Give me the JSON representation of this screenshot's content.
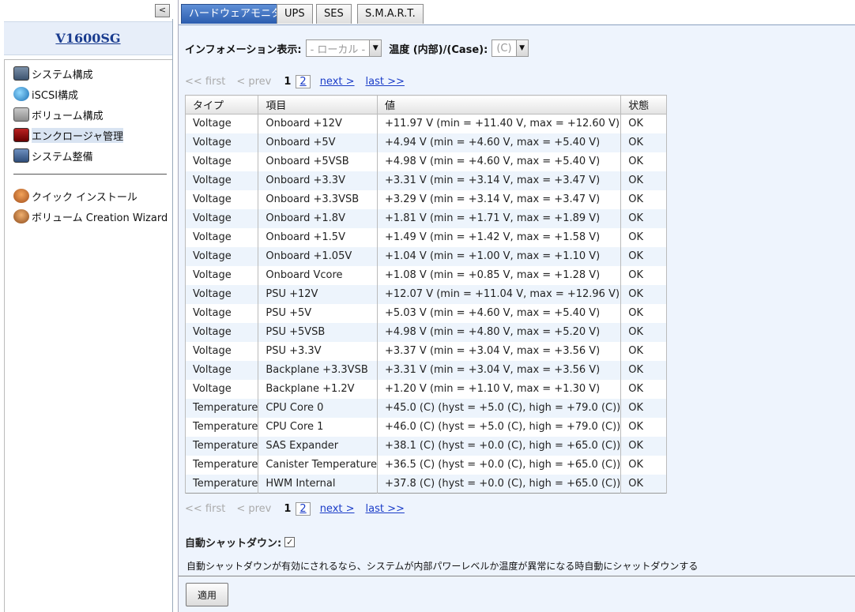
{
  "sidebar": {
    "collapse_glyph": "<",
    "device_name": "V1600SG",
    "nav_items": [
      {
        "label": "システム構成",
        "icon": "system-config-icon"
      },
      {
        "label": "iSCSI構成",
        "icon": "iscsi-globe-icon"
      },
      {
        "label": "ボリューム構成",
        "icon": "volume-disk-icon"
      },
      {
        "label": "エンクロージャ管理",
        "icon": "enclosure-monitor-icon",
        "active": true
      },
      {
        "label": "システム整備",
        "icon": "maintenance-icon"
      }
    ],
    "wizard_items": [
      {
        "label": "クイック インストール",
        "icon": "quick-install-icon"
      },
      {
        "label": "ボリューム Creation Wizard",
        "icon": "volume-wizard-icon"
      }
    ]
  },
  "tabs": [
    {
      "label": "ハードウェアモニタ",
      "active": true
    },
    {
      "label": "UPS"
    },
    {
      "label": "SES"
    },
    {
      "label": "S.M.A.R.T."
    }
  ],
  "info": {
    "label": "インフォメーション表示:",
    "select_value": "- ローカル -",
    "temp_label": "温度 (内部)/(Case):",
    "temp_value": "(C)"
  },
  "pager": {
    "first": "<< first",
    "prev": "< prev",
    "current": "1",
    "page2": "2",
    "next": "next >",
    "last": "last >>"
  },
  "table": {
    "headers": [
      "タイプ",
      "項目",
      "値",
      "状態"
    ],
    "rows": [
      [
        "Voltage",
        "Onboard +12V",
        "+11.97 V (min = +11.40 V, max = +12.60 V)",
        "OK"
      ],
      [
        "Voltage",
        "Onboard +5V",
        "+4.94 V (min = +4.60 V, max = +5.40 V)",
        "OK"
      ],
      [
        "Voltage",
        "Onboard +5VSB",
        "+4.98 V (min = +4.60 V, max = +5.40 V)",
        "OK"
      ],
      [
        "Voltage",
        "Onboard +3.3V",
        "+3.31 V (min = +3.14 V, max = +3.47 V)",
        "OK"
      ],
      [
        "Voltage",
        "Onboard +3.3VSB",
        "+3.29 V (min = +3.14 V, max = +3.47 V)",
        "OK"
      ],
      [
        "Voltage",
        "Onboard +1.8V",
        "+1.81 V (min = +1.71 V, max = +1.89 V)",
        "OK"
      ],
      [
        "Voltage",
        "Onboard +1.5V",
        "+1.49 V (min = +1.42 V, max = +1.58 V)",
        "OK"
      ],
      [
        "Voltage",
        "Onboard +1.05V",
        "+1.04 V (min = +1.00 V, max = +1.10 V)",
        "OK"
      ],
      [
        "Voltage",
        "Onboard Vcore",
        "+1.08 V (min = +0.85 V, max = +1.28 V)",
        "OK"
      ],
      [
        "Voltage",
        "PSU +12V",
        "+12.07 V (min = +11.04 V, max = +12.96 V)",
        "OK"
      ],
      [
        "Voltage",
        "PSU +5V",
        "+5.03 V (min = +4.60 V, max = +5.40 V)",
        "OK"
      ],
      [
        "Voltage",
        "PSU +5VSB",
        "+4.98 V (min = +4.80 V, max = +5.20 V)",
        "OK"
      ],
      [
        "Voltage",
        "PSU +3.3V",
        "+3.37 V (min = +3.04 V, max = +3.56 V)",
        "OK"
      ],
      [
        "Voltage",
        "Backplane +3.3VSB",
        "+3.31 V (min = +3.04 V, max = +3.56 V)",
        "OK"
      ],
      [
        "Voltage",
        "Backplane +1.2V",
        "+1.20 V (min = +1.10 V, max = +1.30 V)",
        "OK"
      ],
      [
        "Temperature",
        "CPU Core 0",
        "+45.0 (C) (hyst = +5.0 (C), high = +79.0 (C))",
        "OK"
      ],
      [
        "Temperature",
        "CPU Core 1",
        "+46.0 (C) (hyst = +5.0 (C), high = +79.0 (C))",
        "OK"
      ],
      [
        "Temperature",
        "SAS Expander",
        "+38.1 (C) (hyst = +0.0 (C), high = +65.0 (C))",
        "OK"
      ],
      [
        "Temperature",
        "Canister Temperature",
        "+36.5 (C) (hyst = +0.0 (C), high = +65.0 (C))",
        "OK"
      ],
      [
        "Temperature",
        "HWM Internal",
        "+37.8 (C) (hyst = +0.0 (C), high = +65.0 (C))",
        "OK"
      ]
    ]
  },
  "auto_shutdown": {
    "label": "自動シャットダウン:",
    "checked": true,
    "check_glyph": "✓",
    "description": "自動シャットダウンが有効にされるなら、システムが内部パワーレベルか温度が異常になる時自動にシャットダウンする"
  },
  "apply_label": "適用"
}
